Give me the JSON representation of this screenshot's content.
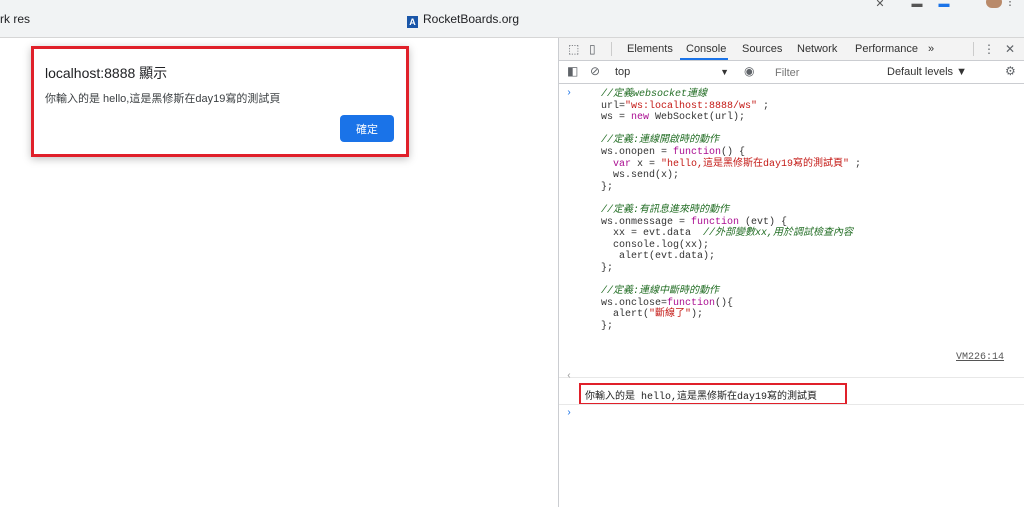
{
  "bookmarks": {
    "left_fragment": "rk res",
    "rocketboards": "RocketBoards.org"
  },
  "dialog": {
    "title": "localhost:8888 顯示",
    "message": "你輸入的是 hello,這是黑修斯在day19寫的測試頁",
    "ok_label": "確定"
  },
  "devtools": {
    "tabs": [
      "Elements",
      "Console",
      "Sources",
      "Network",
      "Performance"
    ],
    "more_tabs": "»",
    "context": "top",
    "filter_placeholder": "Filter",
    "levels": "Default levels ▼",
    "code": [
      {
        "c": "cm",
        "t": "//定義websocket連線"
      },
      {
        "c": "mix",
        "parts": [
          [
            "op",
            "url="
          ],
          [
            "str",
            "\"ws:localhost:8888/ws\""
          ],
          [
            "op",
            " ;"
          ]
        ]
      },
      {
        "c": "mix",
        "parts": [
          [
            "op",
            "ws = "
          ],
          [
            "kw",
            "new"
          ],
          [
            "op",
            " WebSocket(url);"
          ]
        ]
      },
      {
        "c": "blank",
        "t": ""
      },
      {
        "c": "cm",
        "t": "//定義:連線開啟時的動作"
      },
      {
        "c": "mix",
        "parts": [
          [
            "op",
            "ws.onopen = "
          ],
          [
            "kw",
            "function"
          ],
          [
            "op",
            "() {"
          ]
        ]
      },
      {
        "c": "mix",
        "parts": [
          [
            "kw",
            "  var"
          ],
          [
            "op",
            " x = "
          ],
          [
            "str",
            "\"hello,這是黑修斯在day19寫的測試頁\""
          ],
          [
            "op",
            " ;"
          ]
        ]
      },
      {
        "c": "op",
        "t": "  ws.send(x);"
      },
      {
        "c": "op",
        "t": "};"
      },
      {
        "c": "blank",
        "t": ""
      },
      {
        "c": "cm",
        "t": "//定義:有訊息進來時的動作"
      },
      {
        "c": "mix",
        "parts": [
          [
            "op",
            "ws.onmessage = "
          ],
          [
            "kw",
            "function"
          ],
          [
            "op",
            " (evt) {"
          ]
        ]
      },
      {
        "c": "mix",
        "parts": [
          [
            "op",
            "  xx = evt.data  "
          ],
          [
            "cm",
            "//外部變數xx,用於調試檢查內容"
          ]
        ]
      },
      {
        "c": "op",
        "t": "  console.log(xx);"
      },
      {
        "c": "op",
        "t": "   alert(evt.data);"
      },
      {
        "c": "op",
        "t": "};"
      },
      {
        "c": "blank",
        "t": ""
      },
      {
        "c": "cm",
        "t": "//定義:連線中斷時的動作"
      },
      {
        "c": "mix",
        "parts": [
          [
            "op",
            "ws.onclose="
          ],
          [
            "kw",
            "function"
          ],
          [
            "op",
            "(){"
          ]
        ]
      },
      {
        "c": "mix",
        "parts": [
          [
            "op",
            "  alert("
          ],
          [
            "str",
            "\"斷線了\""
          ],
          [
            "op",
            ");"
          ]
        ]
      },
      {
        "c": "op",
        "t": "};"
      }
    ],
    "log_output": "你輸入的是 hello,這是黑修斯在day19寫的測試頁",
    "log_source": "VM226:14"
  }
}
